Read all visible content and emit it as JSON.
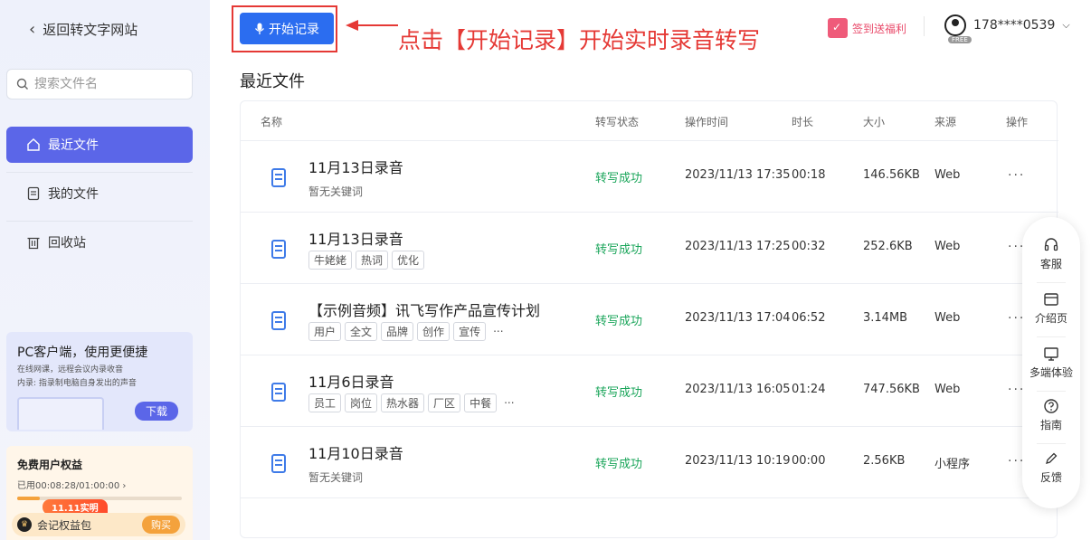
{
  "sidebar": {
    "back_label": "返回转文字网站",
    "search_placeholder": "搜索文件名",
    "nav": [
      {
        "label": "最近文件"
      },
      {
        "label": "我的文件"
      },
      {
        "label": "回收站"
      }
    ],
    "promo": {
      "title": "PC客户端，使用更便捷",
      "line1": "在线网课，远程会议内录收音",
      "line2": "内录: 指录制电脑自身发出的声音",
      "button": "下载"
    },
    "benefit": {
      "title": "免费用户权益",
      "usage": "已用00:08:28/01:00:00 ›",
      "usage_progress": 0.14,
      "badge": "11.11实明",
      "pack_label": "会记权益包",
      "pack_button": "购买"
    }
  },
  "header": {
    "start_record_label": "开始记录",
    "annotation": "点击【开始记录】开始实时录音转写",
    "checkin_label": "签到送福利",
    "user_phone": "178****0539",
    "free_tag": "FREE"
  },
  "main": {
    "section_title": "最近文件",
    "columns": [
      "名称",
      "转写状态",
      "操作时间",
      "时长",
      "大小",
      "来源",
      "操作"
    ],
    "rows": [
      {
        "name": "11月13日录音",
        "keywords_text": "暂无关键词",
        "tags": [],
        "more": false,
        "status": "转写成功",
        "time": "2023/11/13 17:35",
        "duration": "00:18",
        "size": "146.56KB",
        "source": "Web",
        "ops": "···"
      },
      {
        "name": "11月13日录音",
        "keywords_text": "",
        "tags": [
          "牛姥姥",
          "热词",
          "优化"
        ],
        "more": false,
        "status": "转写成功",
        "time": "2023/11/13 17:25",
        "duration": "00:32",
        "size": "252.6KB",
        "source": "Web",
        "ops": "···"
      },
      {
        "name": "【示例音频】讯飞写作产品宣传计划",
        "keywords_text": "",
        "tags": [
          "用户",
          "全文",
          "品牌",
          "创作",
          "宣传"
        ],
        "more": true,
        "status": "转写成功",
        "time": "2023/11/13 17:04",
        "duration": "06:52",
        "size": "3.14MB",
        "source": "Web",
        "ops": "···"
      },
      {
        "name": "11月6日录音",
        "keywords_text": "",
        "tags": [
          "员工",
          "岗位",
          "热水器",
          "厂区",
          "中餐"
        ],
        "more": true,
        "status": "转写成功",
        "time": "2023/11/13 16:05",
        "duration": "01:24",
        "size": "747.56KB",
        "source": "Web",
        "ops": "···"
      },
      {
        "name": "11月10日录音",
        "keywords_text": "暂无关键词",
        "tags": [],
        "more": false,
        "status": "转写成功",
        "time": "2023/11/13 10:19",
        "duration": "00:00",
        "size": "2.56KB",
        "source": "小程序",
        "ops": "···"
      }
    ],
    "more_text": "..."
  },
  "float_bar": {
    "items": [
      {
        "label": "客服",
        "icon": "headset-icon",
        "glyph": "🎧"
      },
      {
        "label": "介绍页",
        "icon": "browser-icon",
        "glyph": "▭"
      },
      {
        "label": "多端体验",
        "icon": "monitor-icon",
        "glyph": "🖵"
      },
      {
        "label": "指南",
        "icon": "help-icon",
        "glyph": "?"
      },
      {
        "label": "反馈",
        "icon": "pen-icon",
        "glyph": "✎"
      }
    ]
  },
  "colors": {
    "accent": "#5b66e8",
    "primary_button": "#2b6df0",
    "annotation_red": "#e53935",
    "status_green": "#1aa55a"
  }
}
